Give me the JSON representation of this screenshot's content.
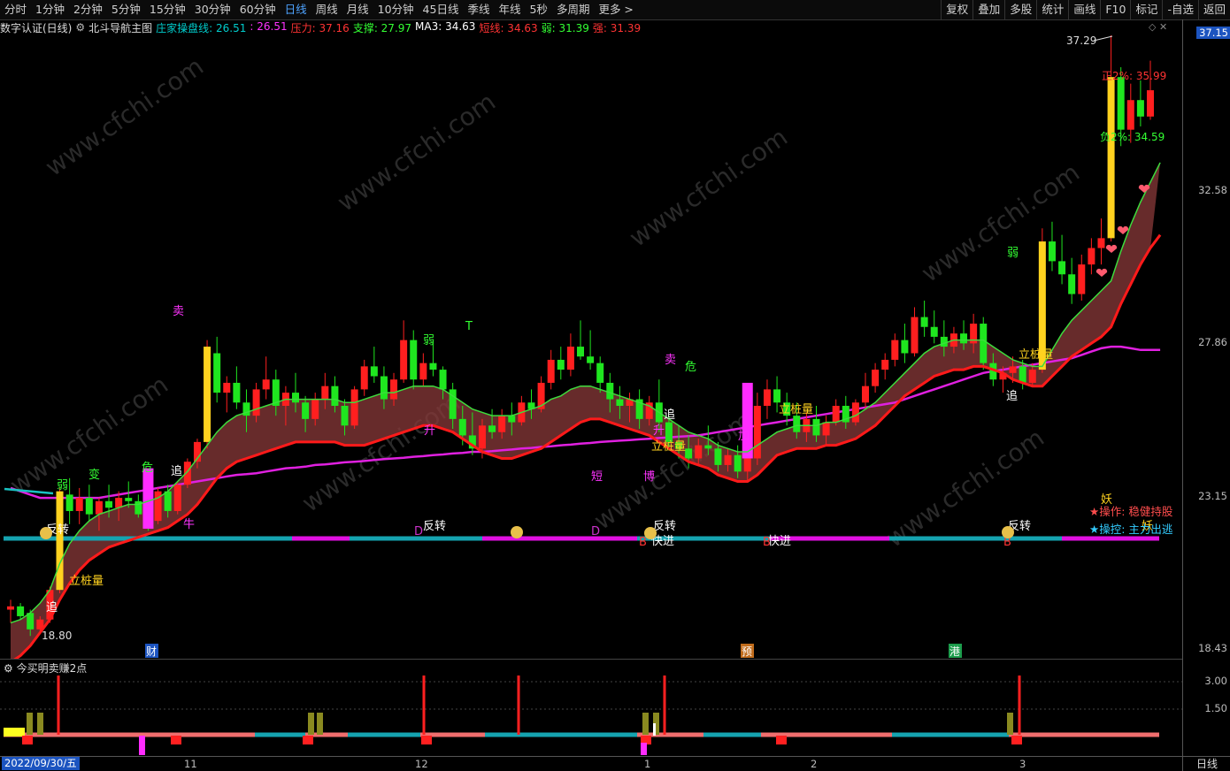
{
  "toolbar": {
    "periods": [
      "分时",
      "1分钟",
      "2分钟",
      "5分钟",
      "15分钟",
      "30分钟",
      "60分钟",
      "日线",
      "周线",
      "月线",
      "10分钟",
      "45日线",
      "季线",
      "年线",
      "5秒",
      "多周期",
      "更多 >"
    ],
    "active_period": "日线",
    "right_buttons": [
      "复权",
      "叠加",
      "多股",
      "统计",
      "画线",
      "F10",
      "标记",
      "-自选",
      "返回"
    ]
  },
  "info_bar": {
    "title": "数字认证(日线)",
    "indicator_name": "北斗导航主图",
    "items": [
      {
        "label": "庄家操盘线: 26.51",
        "color": "#00cccc"
      },
      {
        "label": ": 26.51",
        "color": "#ff33ff"
      },
      {
        "label": "压力: 37.16",
        "color": "#ff3333"
      },
      {
        "label": "支撑: 27.97",
        "color": "#33ff33"
      },
      {
        "label": "MA3: 34.63",
        "color": "#ffffff"
      },
      {
        "label": "短线: 34.63",
        "color": "#ff3333"
      },
      {
        "label": "弱: 31.39",
        "color": "#33ff33"
      },
      {
        "label": "强: 31.39",
        "color": "#ff3333"
      }
    ]
  },
  "y_axis": {
    "current_price": "37.15",
    "labels": [
      "32.58",
      "27.86",
      "23.15",
      "18.43"
    ]
  },
  "sub_axis": {
    "labels": [
      "3.00",
      "1.50"
    ]
  },
  "x_axis": {
    "start_date": "2022/09/30/五",
    "months": [
      "11",
      "12",
      "1",
      "2",
      "3"
    ]
  },
  "period_button": "日线",
  "sub_indicator": {
    "title": "今买明卖赚2点"
  },
  "chart_labels": {
    "high": "37.29",
    "low": "18.80",
    "upper_pct": "正2%: 35.99",
    "lower_pct": "负2%: 34.59",
    "events": [
      "财",
      "预",
      "港"
    ],
    "signals": [
      "立桩量",
      "立桩量",
      "立桩量",
      "立桩量",
      "反转",
      "反转",
      "反转",
      "反转",
      "快进",
      "快进",
      "追",
      "追",
      "追",
      "追",
      "弱",
      "弱",
      "弱",
      "危",
      "危",
      "卖",
      "卖",
      "变",
      "T",
      "升",
      "升",
      "短",
      "博",
      "牛",
      "加",
      "D",
      "D",
      "B",
      "B",
      "B",
      "妖",
      "妖"
    ]
  },
  "ops": {
    "op_label": "★操作: 稳健持股",
    "ctrl_label": "★操控: 主力出逃"
  },
  "watermark": "www.cfchi.com",
  "chart_data": {
    "type": "candlestick",
    "y_range": [
      18.43,
      37.15
    ],
    "candles": [
      [
        19.6,
        19.9,
        19.2,
        19.7
      ],
      [
        19.7,
        19.8,
        19.3,
        19.4
      ],
      [
        19.5,
        19.6,
        18.8,
        19.0
      ],
      [
        19.0,
        19.4,
        18.9,
        19.3
      ],
      [
        19.3,
        20.3,
        19.2,
        20.2
      ],
      [
        20.2,
        23.3,
        20.1,
        23.2
      ],
      [
        23.1,
        23.6,
        22.2,
        22.6
      ],
      [
        22.6,
        23.3,
        22.2,
        23.0
      ],
      [
        23.0,
        23.4,
        22.3,
        22.5
      ],
      [
        22.5,
        23.0,
        22.0,
        22.9
      ],
      [
        22.9,
        23.4,
        22.4,
        22.7
      ],
      [
        22.7,
        23.2,
        22.3,
        23.0
      ],
      [
        23.0,
        23.5,
        22.7,
        22.9
      ],
      [
        22.9,
        23.1,
        22.4,
        22.5
      ],
      [
        22.5,
        22.9,
        22.0,
        22.3
      ],
      [
        22.3,
        23.3,
        22.2,
        23.2
      ],
      [
        23.2,
        23.4,
        22.4,
        22.6
      ],
      [
        22.6,
        23.5,
        22.5,
        23.4
      ],
      [
        23.4,
        24.2,
        23.3,
        24.1
      ],
      [
        24.1,
        24.8,
        23.9,
        24.7
      ],
      [
        24.7,
        27.8,
        24.5,
        27.6
      ],
      [
        27.4,
        27.9,
        25.9,
        26.2
      ],
      [
        26.2,
        26.7,
        25.6,
        26.5
      ],
      [
        26.5,
        27.0,
        25.7,
        25.9
      ],
      [
        25.9,
        26.3,
        25.0,
        25.5
      ],
      [
        25.5,
        26.5,
        25.3,
        26.3
      ],
      [
        26.3,
        27.3,
        26.0,
        26.6
      ],
      [
        26.6,
        26.9,
        25.5,
        25.8
      ],
      [
        25.8,
        26.4,
        25.2,
        26.2
      ],
      [
        26.2,
        26.8,
        25.6,
        25.9
      ],
      [
        25.9,
        26.1,
        25.0,
        25.4
      ],
      [
        25.4,
        26.2,
        25.2,
        26.0
      ],
      [
        26.0,
        26.8,
        25.7,
        26.4
      ],
      [
        26.4,
        26.7,
        25.6,
        25.8
      ],
      [
        25.8,
        26.0,
        24.9,
        25.2
      ],
      [
        25.2,
        26.4,
        25.1,
        26.3
      ],
      [
        26.3,
        27.2,
        26.1,
        27.0
      ],
      [
        27.0,
        27.6,
        26.5,
        26.7
      ],
      [
        26.7,
        27.0,
        25.7,
        26.0
      ],
      [
        26.0,
        26.8,
        25.8,
        26.6
      ],
      [
        26.6,
        28.4,
        26.5,
        27.8
      ],
      [
        27.8,
        28.1,
        26.3,
        26.6
      ],
      [
        26.6,
        27.4,
        26.4,
        27.1
      ],
      [
        27.1,
        27.8,
        26.7,
        26.9
      ],
      [
        26.9,
        27.0,
        26.0,
        26.3
      ],
      [
        26.3,
        26.5,
        25.1,
        25.4
      ],
      [
        25.4,
        25.8,
        24.6,
        24.9
      ],
      [
        24.9,
        25.6,
        24.3,
        24.5
      ],
      [
        24.5,
        25.4,
        24.2,
        25.2
      ],
      [
        25.2,
        25.7,
        24.8,
        25.0
      ],
      [
        25.0,
        25.7,
        24.8,
        25.5
      ],
      [
        25.5,
        25.9,
        24.9,
        25.3
      ],
      [
        25.3,
        26.1,
        25.2,
        25.9
      ],
      [
        25.9,
        26.3,
        25.4,
        25.7
      ],
      [
        25.7,
        26.7,
        25.6,
        26.5
      ],
      [
        26.5,
        27.5,
        26.3,
        27.2
      ],
      [
        27.2,
        27.6,
        26.6,
        26.9
      ],
      [
        26.9,
        28.0,
        26.7,
        27.6
      ],
      [
        27.6,
        28.4,
        27.2,
        27.3
      ],
      [
        27.3,
        28.1,
        26.9,
        27.1
      ],
      [
        27.1,
        27.3,
        26.2,
        26.5
      ],
      [
        26.5,
        26.8,
        25.6,
        26.0
      ],
      [
        26.0,
        26.4,
        25.4,
        25.8
      ],
      [
        25.8,
        26.2,
        25.3,
        26.0
      ],
      [
        26.0,
        26.3,
        25.1,
        25.4
      ],
      [
        25.4,
        26.1,
        25.2,
        25.9
      ],
      [
        25.9,
        26.6,
        25.0,
        25.3
      ],
      [
        25.3,
        25.5,
        24.5,
        24.7
      ],
      [
        24.7,
        25.2,
        24.2,
        24.5
      ],
      [
        24.5,
        24.9,
        23.9,
        24.2
      ],
      [
        24.2,
        24.8,
        24.0,
        24.6
      ],
      [
        24.6,
        25.2,
        24.3,
        24.5
      ],
      [
        24.5,
        24.7,
        23.8,
        24.0
      ],
      [
        24.0,
        24.5,
        23.8,
        24.3
      ],
      [
        24.3,
        24.6,
        23.6,
        23.8
      ],
      [
        23.8,
        24.4,
        23.5,
        24.2
      ],
      [
        24.2,
        26.2,
        24.0,
        25.8
      ],
      [
        25.8,
        26.6,
        25.4,
        26.3
      ],
      [
        26.3,
        26.7,
        25.6,
        25.9
      ],
      [
        25.9,
        26.2,
        25.2,
        25.5
      ],
      [
        25.5,
        25.9,
        24.8,
        25.0
      ],
      [
        25.0,
        25.6,
        24.7,
        25.4
      ],
      [
        25.4,
        25.8,
        24.7,
        24.9
      ],
      [
        24.9,
        25.5,
        24.6,
        25.3
      ],
      [
        25.3,
        26.0,
        25.2,
        25.8
      ],
      [
        25.8,
        26.1,
        25.1,
        25.3
      ],
      [
        25.3,
        26.0,
        25.2,
        25.9
      ],
      [
        25.9,
        26.8,
        25.7,
        26.4
      ],
      [
        26.4,
        27.1,
        26.2,
        26.9
      ],
      [
        26.9,
        27.4,
        26.6,
        27.2
      ],
      [
        27.2,
        28.0,
        27.0,
        27.8
      ],
      [
        27.8,
        28.3,
        27.1,
        27.4
      ],
      [
        27.4,
        28.8,
        27.3,
        28.5
      ],
      [
        28.5,
        29.0,
        27.9,
        28.2
      ],
      [
        28.2,
        28.7,
        27.7,
        27.9
      ],
      [
        27.9,
        28.4,
        27.3,
        27.6
      ],
      [
        27.6,
        28.2,
        27.4,
        28.0
      ],
      [
        28.0,
        28.4,
        27.5,
        27.7
      ],
      [
        27.7,
        28.6,
        27.4,
        28.3
      ],
      [
        28.3,
        28.5,
        26.9,
        27.1
      ],
      [
        27.1,
        27.4,
        26.4,
        26.6
      ],
      [
        26.6,
        27.0,
        26.2,
        26.8
      ],
      [
        26.8,
        27.3,
        26.5,
        27.0
      ],
      [
        27.0,
        27.2,
        26.3,
        26.5
      ],
      [
        26.5,
        27.1,
        26.4,
        26.9
      ],
      [
        26.9,
        31.2,
        26.8,
        30.8
      ],
      [
        30.8,
        31.4,
        29.9,
        30.2
      ],
      [
        30.2,
        31.0,
        29.5,
        29.8
      ],
      [
        29.8,
        30.3,
        28.9,
        29.2
      ],
      [
        29.2,
        30.4,
        29.0,
        30.1
      ],
      [
        30.1,
        30.9,
        29.8,
        30.6
      ],
      [
        30.6,
        31.5,
        30.1,
        30.9
      ],
      [
        30.9,
        37.3,
        30.8,
        35.8
      ],
      [
        35.8,
        36.1,
        33.7,
        34.2
      ],
      [
        34.2,
        35.6,
        33.8,
        35.1
      ],
      [
        35.1,
        35.7,
        34.3,
        34.6
      ],
      [
        34.6,
        36.3,
        34.5,
        35.4
      ]
    ],
    "support_line_ma": [
      19.2,
      19.3,
      19.5,
      19.8,
      20.2,
      21.0,
      21.6,
      22.0,
      22.3,
      22.5,
      22.6,
      22.7,
      22.8,
      22.8,
      22.9,
      23.0,
      23.2,
      23.5,
      23.8,
      24.2,
      24.6,
      25.0,
      25.3,
      25.5,
      25.6,
      25.7,
      25.8,
      25.9,
      26.0,
      26.0,
      26.0,
      26.0,
      26.0,
      26.0,
      25.9,
      25.9,
      26.0,
      26.1,
      26.2,
      26.2,
      26.3,
      26.4,
      26.4,
      26.4,
      26.3,
      26.1,
      25.9,
      25.7,
      25.6,
      25.5,
      25.5,
      25.5,
      25.6,
      25.7,
      25.8,
      26.0,
      26.1,
      26.3,
      26.4,
      26.4,
      26.3,
      26.2,
      26.1,
      26.0,
      25.9,
      25.8,
      25.6,
      25.4,
      25.2,
      25.0,
      24.9,
      24.8,
      24.6,
      24.5,
      24.4,
      24.4,
      24.6,
      24.8,
      25.0,
      25.1,
      25.2,
      25.2,
      25.2,
      25.3,
      25.3,
      25.4,
      25.5,
      25.7,
      25.9,
      26.2,
      26.5,
      26.8,
      27.1,
      27.4,
      27.6,
      27.7,
      27.8,
      27.8,
      27.8,
      27.8,
      27.6,
      27.4,
      27.2,
      27.1,
      27.0,
      27.0,
      27.5,
      28.0,
      28.4,
      28.7,
      29.0,
      29.3,
      29.6,
      30.5,
      31.3,
      32.0,
      32.6,
      33.2
    ],
    "strong_line": [
      18.9,
      19.1,
      19.4,
      19.8,
      20.2,
      20.8,
      21.3,
      21.7,
      22.0,
      22.2,
      22.4,
      22.5,
      22.6,
      22.7,
      22.8,
      22.9,
      23.0,
      23.2,
      23.4,
      23.7,
      24.1,
      24.5,
      24.8,
      25.0,
      25.1,
      25.2,
      25.3,
      25.4,
      25.5,
      25.6,
      25.6,
      25.6,
      25.6,
      25.6,
      25.5,
      25.5,
      25.5,
      25.6,
      25.7,
      25.8,
      25.9,
      26.0,
      26.1,
      26.1,
      26.0,
      25.9,
      25.7,
      25.5,
      25.3,
      25.2,
      25.1,
      25.1,
      25.2,
      25.3,
      25.4,
      25.6,
      25.8,
      26.0,
      26.2,
      26.3,
      26.3,
      26.2,
      26.1,
      26.0,
      25.9,
      25.8,
      25.6,
      25.4,
      25.2,
      25.0,
      24.9,
      24.8,
      24.6,
      24.5,
      24.4,
      24.4,
      24.6,
      24.9,
      25.2,
      25.3,
      25.4,
      25.4,
      25.4,
      25.5,
      25.5,
      25.6,
      25.7,
      25.9,
      26.1,
      26.4,
      26.7,
      27.0,
      27.2,
      27.4,
      27.6,
      27.7,
      27.8,
      27.8,
      27.9,
      27.9,
      27.8,
      27.7,
      27.5,
      27.4,
      27.3,
      27.3,
      27.6,
      27.9,
      28.2,
      28.4,
      28.6,
      28.8,
      29.1,
      29.8,
      30.4,
      31.0,
      31.5,
      31.9
    ],
    "operator_line": [
      23.3,
      23.2,
      23.1,
      23.0,
      23.0,
      23.0,
      23.0,
      23.0,
      23.0,
      23.0,
      23.05,
      23.1,
      23.15,
      23.2,
      23.25,
      23.3,
      23.35,
      23.4,
      23.45,
      23.5,
      23.55,
      23.6,
      23.65,
      23.7,
      23.72,
      23.75,
      23.8,
      23.85,
      23.9,
      23.92,
      23.95,
      24.0,
      24.02,
      24.05,
      24.08,
      24.1,
      24.12,
      24.15,
      24.18,
      24.2,
      24.22,
      24.25,
      24.27,
      24.3,
      24.32,
      24.35,
      24.37,
      24.4,
      24.4,
      24.42,
      24.45,
      24.47,
      24.5,
      24.52,
      24.55,
      24.57,
      24.6,
      24.62,
      24.65,
      24.67,
      24.7,
      24.72,
      24.74,
      24.76,
      24.78,
      24.8,
      24.82,
      24.84,
      24.86,
      24.88,
      24.9,
      24.95,
      25.0,
      25.05,
      25.1,
      25.15,
      25.2,
      25.25,
      25.3,
      25.35,
      25.4,
      25.45,
      25.5,
      25.55,
      25.6,
      25.65,
      25.7,
      25.75,
      25.8,
      25.85,
      25.9,
      26.0,
      26.1,
      26.2,
      26.3,
      26.4,
      26.5,
      26.6,
      26.7,
      26.8,
      26.85,
      26.9,
      26.95,
      27.0,
      27.05,
      27.1,
      27.15,
      27.2,
      27.25,
      27.35,
      27.45,
      27.55,
      27.6,
      27.6,
      27.55,
      27.5,
      27.5,
      27.5
    ]
  }
}
